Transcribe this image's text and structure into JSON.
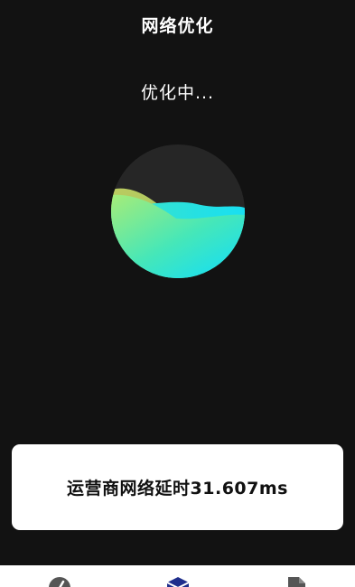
{
  "header": {
    "title": "网络优化"
  },
  "status": {
    "text": "优化中..."
  },
  "card": {
    "latency_text": "运营商网络延时31.607ms"
  },
  "bottom_nav": {
    "items": [
      {
        "icon": "speedometer-icon",
        "active": false
      },
      {
        "icon": "box-icon",
        "active": true
      },
      {
        "icon": "document-icon",
        "active": false
      }
    ]
  },
  "colors": {
    "background": "#121212",
    "orb_dark": "#262626",
    "wave_green": "#b4e86a",
    "wave_cyan": "#1ce3f0",
    "nav_active": "#1f2e8c",
    "nav_inactive": "#555555"
  }
}
